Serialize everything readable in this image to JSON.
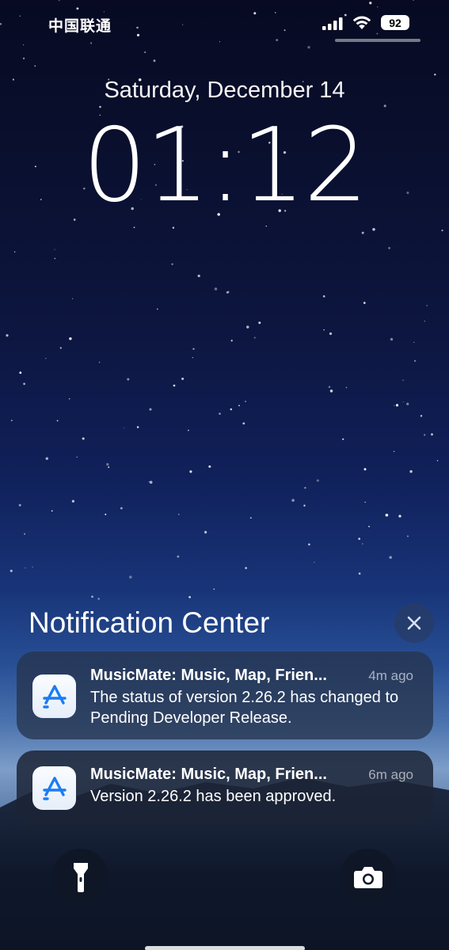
{
  "status_bar": {
    "carrier": "中国联通",
    "battery": "92"
  },
  "lock_screen": {
    "date": "Saturday, December 14",
    "time": "01:12"
  },
  "notification_center": {
    "title": "Notification Center",
    "notifications": [
      {
        "app_icon": "app-store-icon",
        "title": "MusicMate: Music, Map, Frien...",
        "time": "4m ago",
        "body": "The status of version 2.26.2 has changed to Pending Developer Release."
      },
      {
        "app_icon": "app-store-icon",
        "title": "MusicMate: Music, Map, Frien...",
        "time": "6m ago",
        "body": "Version 2.26.2 has been approved."
      }
    ]
  },
  "quick_actions": {
    "left_icon": "flashlight-icon",
    "right_icon": "camera-icon"
  },
  "colors": {
    "app_icon_blue": "#1a7cf5"
  }
}
